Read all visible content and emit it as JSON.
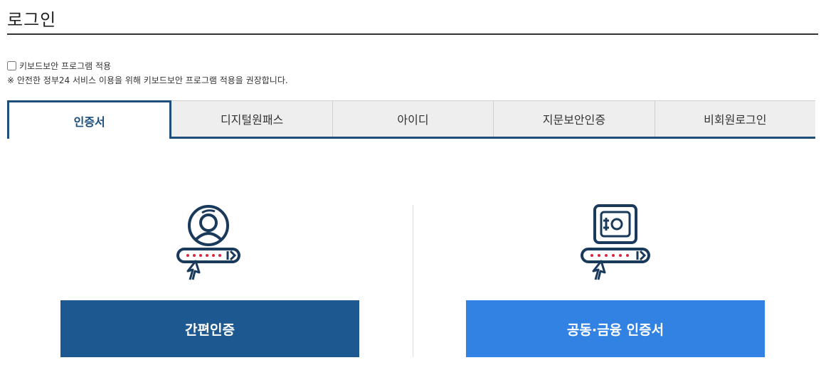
{
  "header": {
    "title": "로그인"
  },
  "keyboard_security": {
    "checkbox_label": "키보드보안 프로그램 적용",
    "checked": false,
    "notice": "※ 안전한 정부24 서비스 이용을 위해 키보드보안 프로그램 적용을 권장합니다."
  },
  "tabs": [
    {
      "label": "인증서",
      "active": true
    },
    {
      "label": "디지털원패스",
      "active": false
    },
    {
      "label": "아이디",
      "active": false
    },
    {
      "label": "지문보안인증",
      "active": false
    },
    {
      "label": "비회원로그인",
      "active": false
    }
  ],
  "methods": {
    "simple_auth": {
      "label": "간편인증",
      "icon": "user-password-icon",
      "color": "#1e5891"
    },
    "joint_cert": {
      "label": "공동·금융 인증서",
      "icon": "safe-password-icon",
      "color": "#3182e3"
    }
  },
  "colors": {
    "primary": "#1e4f7c",
    "icon_dark": "#1a3a5c",
    "dot_red": "#e0243a"
  }
}
